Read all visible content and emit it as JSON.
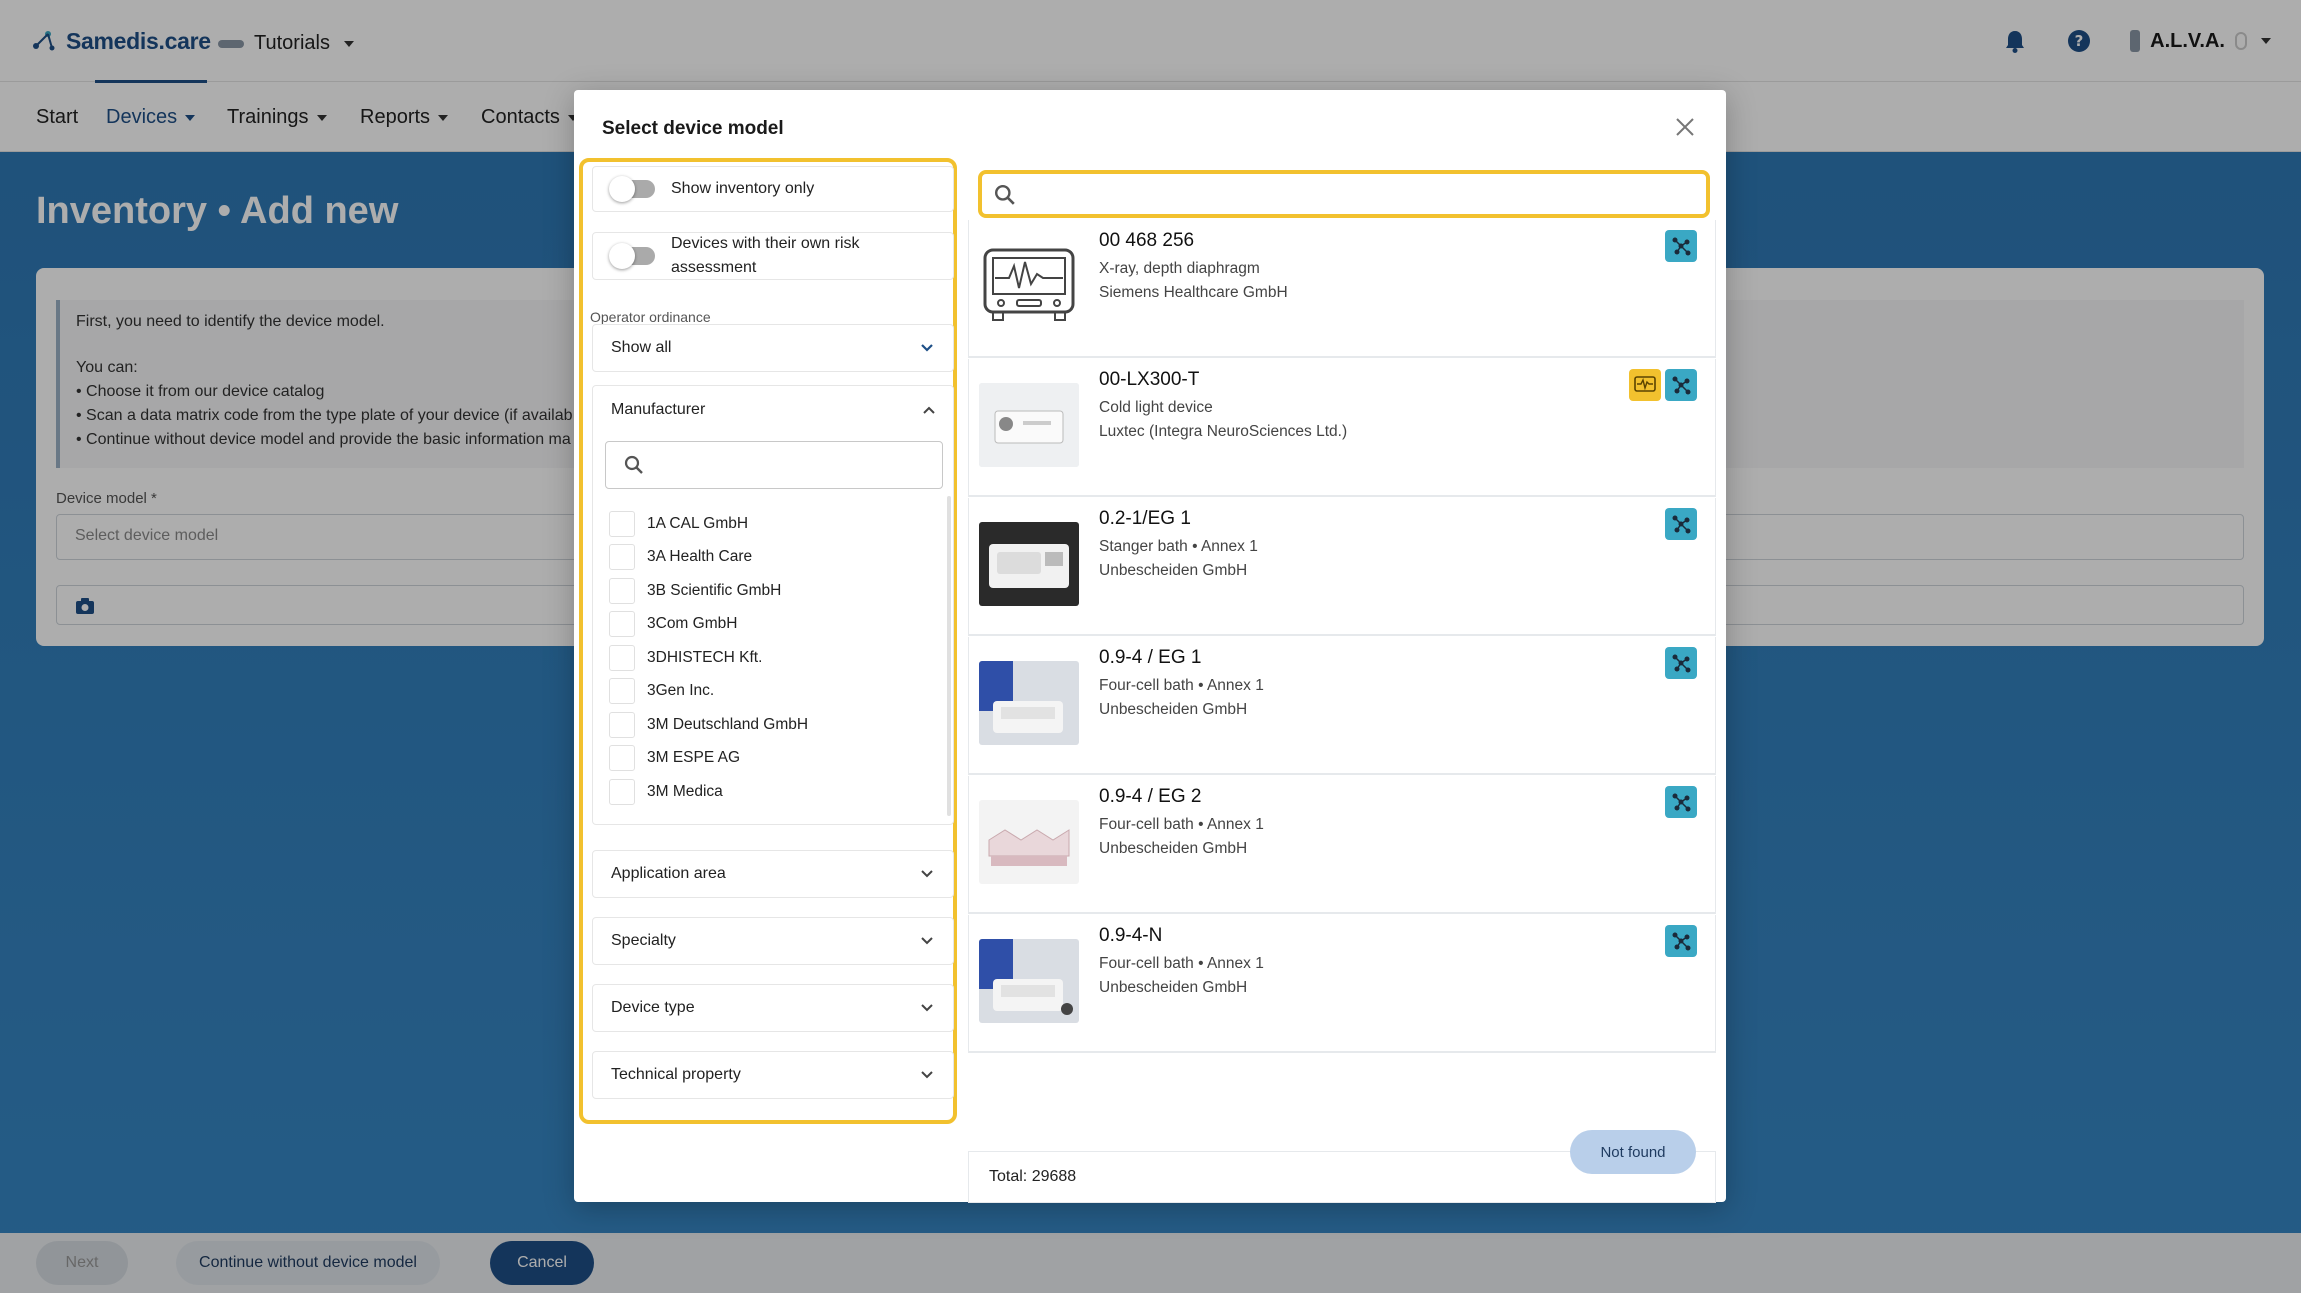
{
  "app": {
    "logo_text": "Samedis.care",
    "tenant": "Tutorials",
    "user": "A.L.V.A."
  },
  "nav": {
    "items": [
      {
        "label": "Start"
      },
      {
        "label": "Devices"
      },
      {
        "label": "Trainings"
      },
      {
        "label": "Reports"
      },
      {
        "label": "Contacts"
      }
    ]
  },
  "page": {
    "title": "Inventory • Add new",
    "info_line1": "First, you need to identify the device model.",
    "info_line2": "You can:",
    "info_bullet1": "• Choose it from our device catalog",
    "info_bullet2": "• Scan a data matrix code from the type plate of your device (if availab",
    "info_bullet3": "• Continue without device model and provide the basic information ma",
    "device_model_label": "Device model *",
    "device_model_placeholder": "Select device model"
  },
  "footer": {
    "next": "Next",
    "continue_without": "Continue without device model",
    "cancel": "Cancel"
  },
  "modal": {
    "title": "Select device model",
    "show_inventory_only": "Show inventory only",
    "own_risk_line1": "Devices with their own risk",
    "own_risk_line2": "assessment",
    "operator_ordinance_label": "Operator ordinance",
    "operator_ordinance_value": "Show all",
    "manufacturer_header": "Manufacturer",
    "manufacturers": [
      "1A CAL GmbH",
      "3A Health Care",
      "3B Scientific GmbH",
      "3Com GmbH",
      "3DHISTECH Kft.",
      "3Gen Inc.",
      "3M Deutschland GmbH",
      "3M ESPE AG",
      "3M Medica"
    ],
    "accordions": [
      "Application area",
      "Specialty",
      "Device type",
      "Technical property"
    ],
    "results": [
      {
        "title": "00 468 256",
        "subtitle": "X-ray, depth diaphragm",
        "manufacturer": "Siemens Healthcare GmbH"
      },
      {
        "title": "00-LX300-T",
        "subtitle": "Cold light device",
        "manufacturer": "Luxtec (Integra NeuroSciences Ltd.)"
      },
      {
        "title": "0.2-1/EG 1",
        "subtitle": "Stanger bath • Annex 1",
        "manufacturer": "Unbescheiden GmbH"
      },
      {
        "title": "0.9-4 / EG 1",
        "subtitle": "Four-cell bath • Annex 1",
        "manufacturer": "Unbescheiden GmbH"
      },
      {
        "title": "0.9-4 / EG 2",
        "subtitle": "Four-cell bath • Annex 1",
        "manufacturer": "Unbescheiden GmbH"
      },
      {
        "title": "0.9-4-N",
        "subtitle": "Four-cell bath • Annex 1",
        "manufacturer": "Unbescheiden GmbH"
      }
    ],
    "total": "Total: 29688",
    "not_found": "Not found"
  },
  "colors": {
    "brand": "#1e4f87",
    "highlight": "#f2c12e",
    "badge": "#3aa8c4"
  }
}
